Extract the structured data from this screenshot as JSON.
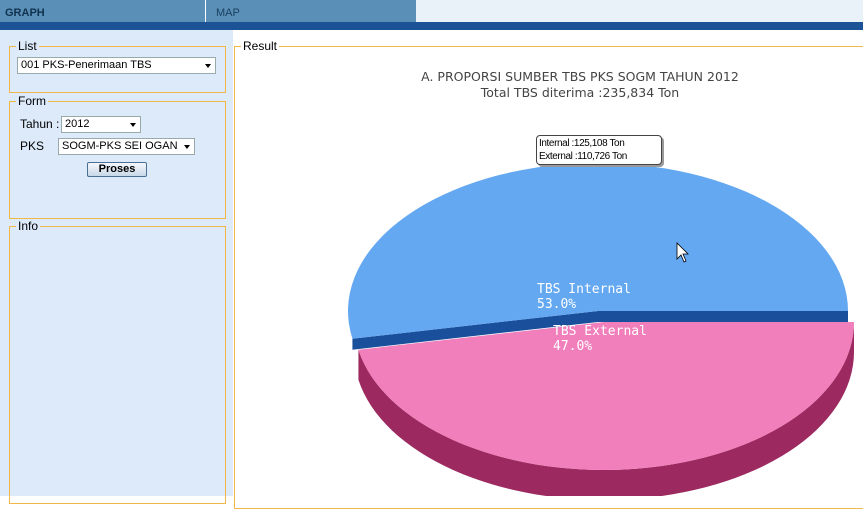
{
  "tabs": [
    {
      "label": "GRAPH",
      "active": true
    },
    {
      "label": "MAP",
      "active": false
    }
  ],
  "list": {
    "legend": "List",
    "selected": "001 PKS-Penerimaan TBS"
  },
  "form": {
    "legend": "Form",
    "tahun_label": "Tahun :",
    "tahun_value": "2012",
    "pks_label": "PKS",
    "pks_value": "SOGM-PKS SEI OGAN",
    "submit_label": "Proses"
  },
  "info": {
    "legend": "Info"
  },
  "result": {
    "legend": "Result"
  },
  "chart_data": {
    "type": "pie",
    "title": "A. PROPORSI SUMBER TBS PKS SOGM TAHUN 2012",
    "subtitle": "Total TBS diterima :235,834 Ton",
    "categories": [
      "TBS Internal",
      "TBS External"
    ],
    "values": [
      53.0,
      47.0
    ],
    "value_labels": [
      "53.0%",
      "47.0%"
    ],
    "colors": [
      "#63a8f0",
      "#f07fbb"
    ],
    "tooltip": [
      "Internal :125,108 Ton",
      "External :110,726 Ton"
    ]
  },
  "colors": {
    "tab_bg": "#5a8fb8",
    "top_bar": "#1b5396",
    "panel_bg": "#dceafa",
    "fieldset_border": "#f0b84a"
  }
}
